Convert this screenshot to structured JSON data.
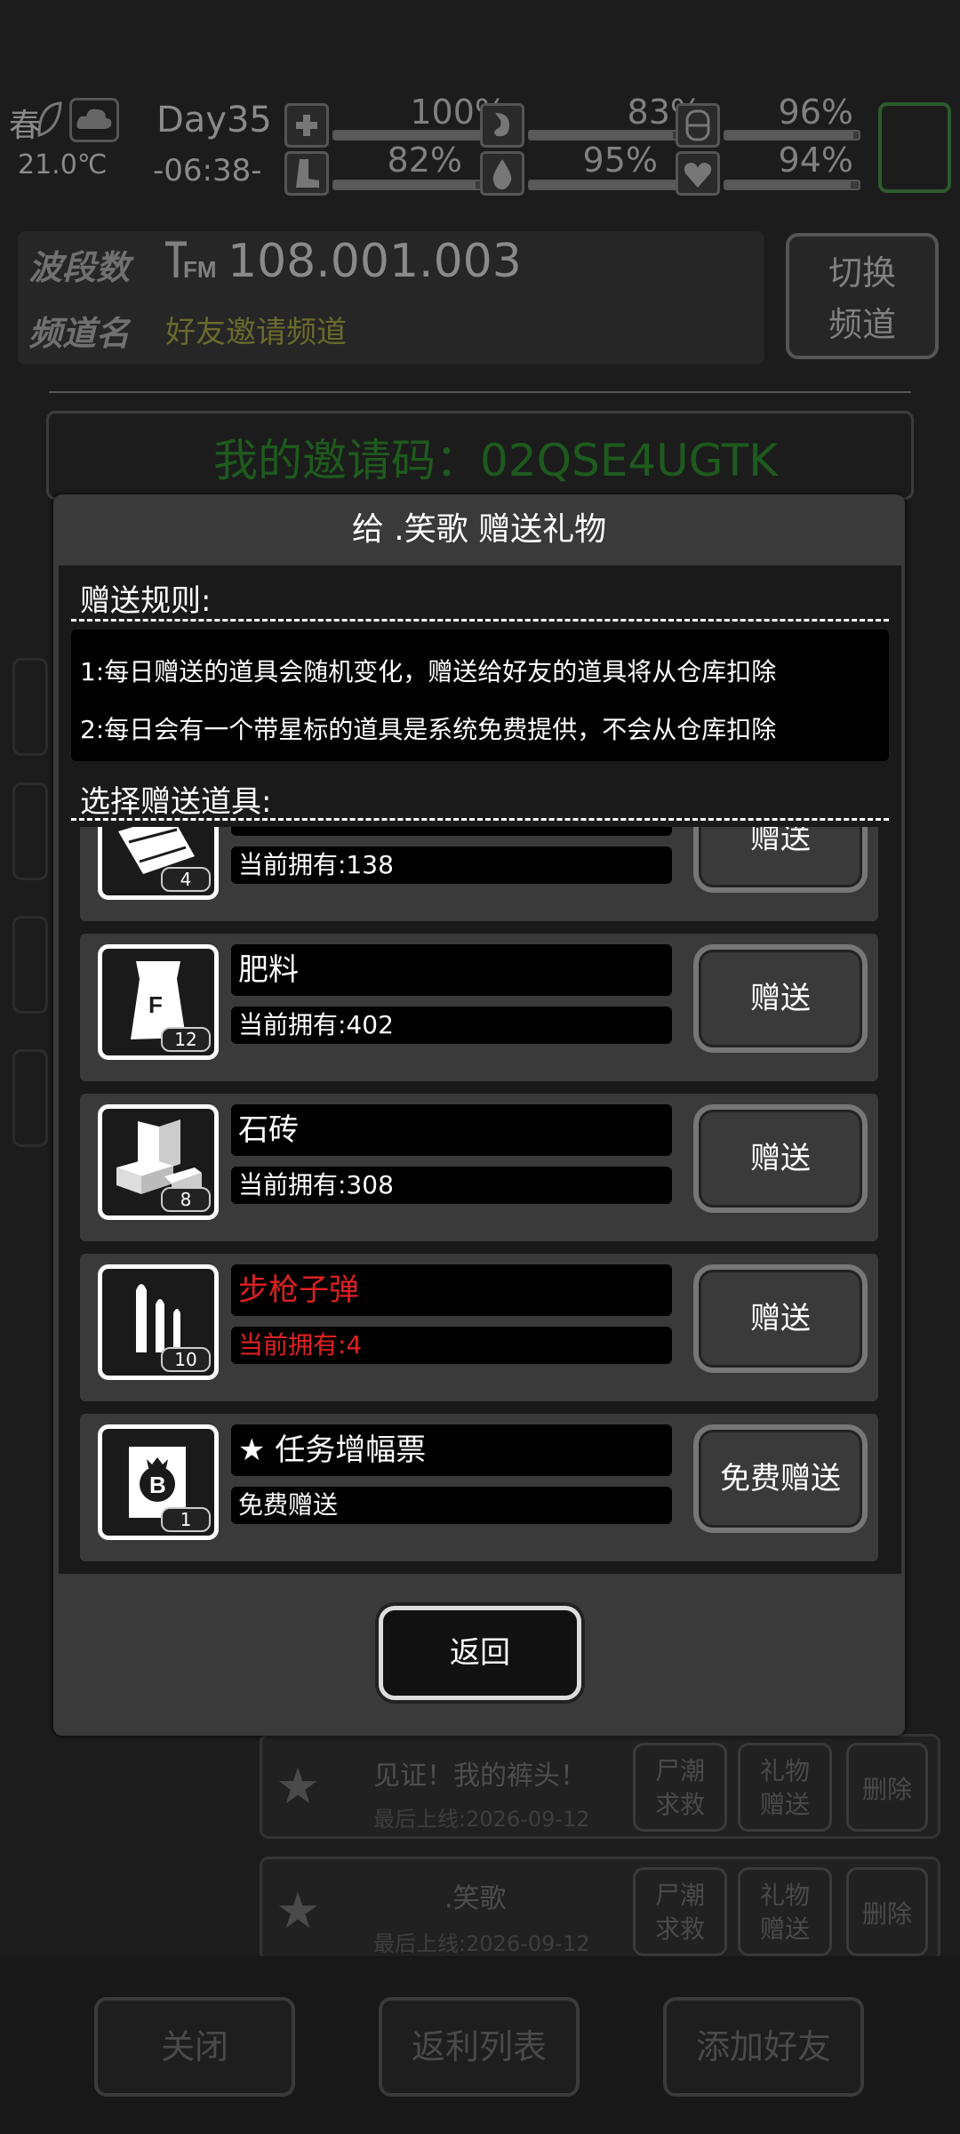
{
  "status": {
    "season": "春",
    "temperature": "21.0℃",
    "day": "Day35",
    "time": "-06:38-",
    "stats": [
      {
        "icon": "medkit-icon",
        "value": "100%",
        "level": 1.0
      },
      {
        "icon": "stomach-icon",
        "value": "83%",
        "level": 0.83
      },
      {
        "icon": "lung-icon",
        "value": "96%",
        "level": 0.96
      },
      {
        "icon": "boot-icon",
        "value": "82%",
        "level": 0.82
      },
      {
        "icon": "water-drop-icon",
        "value": "95%",
        "level": 0.95
      },
      {
        "icon": "heart-icon",
        "value": "94%",
        "level": 0.94
      }
    ]
  },
  "radio": {
    "band_label": "波段数",
    "channel_label": "频道名",
    "frequency": "108.001.003",
    "channel_name": "好友邀请频道",
    "switch_label_1": "切换",
    "switch_label_2": "频道"
  },
  "invite": {
    "label": "我的邀请码：02QSE4UGTK"
  },
  "friends": [
    {
      "name": "见证！我的裤头！",
      "last_online": "最后上线:2026-09-12",
      "rescue_1": "尸潮",
      "rescue_2": "求救",
      "gift_1": "礼物",
      "gift_2": "赠送",
      "delete": "删除"
    },
    {
      "name": ".笑歌",
      "last_online": "最后上线:2026-09-12",
      "rescue_1": "尸潮",
      "rescue_2": "求救",
      "gift_1": "礼物",
      "gift_2": "赠送",
      "delete": "删除"
    }
  ],
  "bottom": {
    "close": "关闭",
    "rebate": "返利列表",
    "add_friend": "添加好友"
  },
  "modal": {
    "title": "给 .笑歌 赠送礼物",
    "rules_label": "赠送规则:",
    "rules": [
      "1:每日赠送的道具会随机变化，赠送给好友的道具将从仓库扣除",
      "2:每日会有一个带星标的道具是系统免费提供，不会从仓库扣除"
    ],
    "select_label": "选择赠送道具:",
    "items": [
      {
        "name": "",
        "owned": "当前拥有:138",
        "qty": "4",
        "button": "赠送",
        "icon": "cloth-icon",
        "warning": false
      },
      {
        "name": "肥料",
        "owned": "当前拥有:402",
        "qty": "12",
        "button": "赠送",
        "icon": "fertilizer-bag-icon",
        "warning": false
      },
      {
        "name": "石砖",
        "owned": "当前拥有:308",
        "qty": "8",
        "button": "赠送",
        "icon": "bricks-icon",
        "warning": false
      },
      {
        "name": "步枪子弹",
        "owned": "当前拥有:4",
        "qty": "10",
        "button": "赠送",
        "icon": "rifle-ammo-icon",
        "warning": true
      },
      {
        "name": "★ 任务增幅票",
        "owned": "免费赠送",
        "qty": "1",
        "button": "免费赠送",
        "icon": "task-ticket-icon",
        "warning": false
      }
    ],
    "back": "返回"
  },
  "colors": {
    "warning": "#e02020",
    "modal_bg": "#3a3a3a",
    "invite_green": "#1e5a1e"
  }
}
